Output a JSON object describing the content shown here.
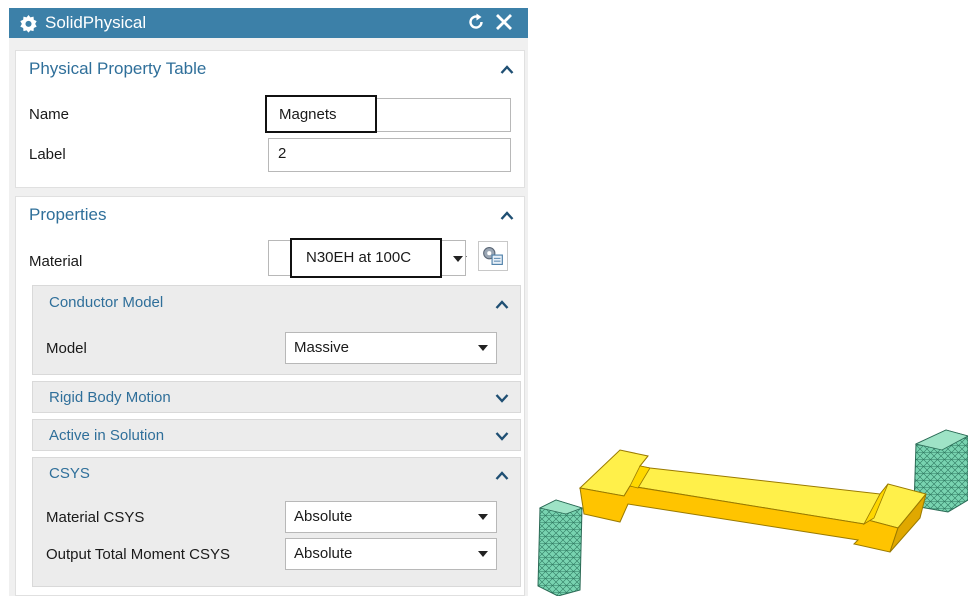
{
  "dialog": {
    "title": "SolidPhysical",
    "title_icon": "gear-icon",
    "reset_icon": "reset-icon",
    "close_icon": "close-icon"
  },
  "physical_property_table": {
    "header": "Physical Property Table",
    "name_label": "Name",
    "name_value": "Magnets",
    "label_label": "Label",
    "label_value": "2"
  },
  "properties": {
    "header": "Properties",
    "material_label": "Material",
    "material_value": "N30EH at 100C",
    "material_picker_icon": "material-library-icon",
    "conductor_model": {
      "header": "Conductor Model",
      "model_label": "Model",
      "model_value": "Massive"
    },
    "rigid_body_motion": {
      "header": "Rigid Body Motion"
    },
    "active_in_solution": {
      "header": "Active in Solution"
    },
    "csys": {
      "header": "CSYS",
      "material_csys_label": "Material CSYS",
      "material_csys_value": "Absolute",
      "output_total_moment_label": "Output Total Moment CSYS",
      "output_total_moment_value": "Absolute"
    }
  },
  "colors": {
    "titlebar": "#3c80a8",
    "section_header": "#2f6f9a",
    "magnet": "#ffcc00",
    "mesh": "#6fcfa8"
  }
}
